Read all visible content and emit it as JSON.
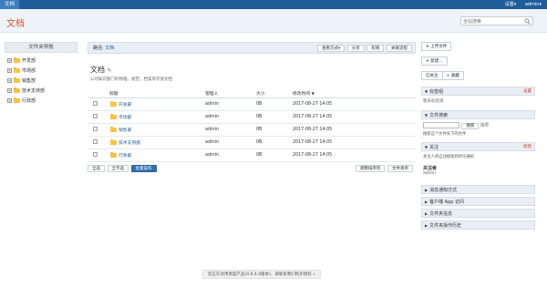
{
  "topbar": {
    "tab": "文档",
    "settings": "设置▾",
    "user": "admin▾"
  },
  "header": {
    "title": "文档",
    "search_placeholder": "全站搜索"
  },
  "leftnav": {
    "title": "文件夹导航",
    "items": [
      {
        "label": "开发部"
      },
      {
        "label": "市场部"
      },
      {
        "label": "销售部"
      },
      {
        "label": "技术支持部"
      },
      {
        "label": "行政部"
      }
    ]
  },
  "main": {
    "crumb_label": "路径:",
    "crumb_link": "文档",
    "toolbar": {
      "view": "查看方式▾",
      "share": "分享",
      "delete": "权限",
      "follow": "关联流程"
    },
    "title": "文档",
    "edit_icon": "✎",
    "description": "公司知识部门的物理，规范，档案等存放文档",
    "columns": {
      "name": "标题",
      "owner": "管理人",
      "size": "大小",
      "modified": "修改时间"
    },
    "rows": [
      {
        "name": "开发部",
        "owner": "admin",
        "size": "0B",
        "modified": "2017-08-27 14:05"
      },
      {
        "name": "市场部",
        "owner": "admin",
        "size": "0B",
        "modified": "2017-08-27 14:05"
      },
      {
        "name": "销售部",
        "owner": "admin",
        "size": "0B",
        "modified": "2017-08-27 14:05"
      },
      {
        "name": "技术支持部",
        "owner": "admin",
        "size": "0B",
        "modified": "2017-08-27 14:05"
      },
      {
        "name": "行政部",
        "owner": "admin",
        "size": "0B",
        "modified": "2017-08-27 14:05"
      }
    ],
    "select_all": "全选",
    "select_none": "全不选",
    "batch": "批量操作",
    "sort": "调整排序列",
    "list": "文件清单"
  },
  "right": {
    "upload": "上传文件",
    "new": "新建...",
    "tag_follow": "已关注",
    "tag_add": "+ 收藏",
    "tags_head": "标签组",
    "tags_act": "设置",
    "tags_body": "暂未标签组",
    "search_head": "文件搜索",
    "search_btn": "搜索",
    "search_opt": "选项",
    "search_hint": "搜索这个文件夹下的文件",
    "follow_head": "关注",
    "follow_act": "修改",
    "follow_body": "关注人将自动接收到评论通知",
    "follower_label": "关注者",
    "follower_name": "admin",
    "s1": "消息通知方式",
    "s2": "客户端 App 访问",
    "s3": "文件夹信息",
    "s4": "文件夹操作历史"
  },
  "footer": {
    "notice": "您正在试用易度产品(4.8.4.4版本)，请联系我们购买授权 »"
  }
}
